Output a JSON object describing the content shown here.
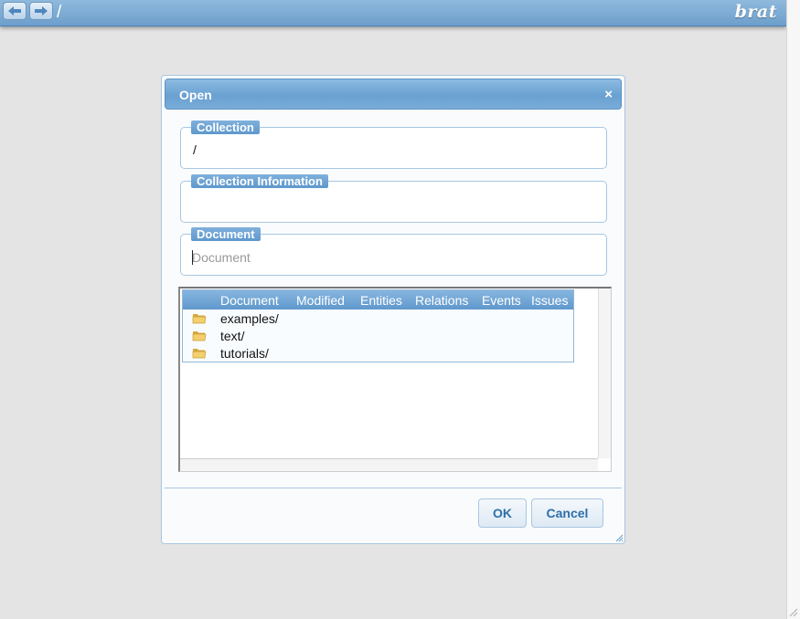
{
  "topbar": {
    "path": "/",
    "brand": "brat",
    "back_icon": "arrow-left-icon",
    "forward_icon": "arrow-right-icon"
  },
  "dialog": {
    "title": "Open",
    "close_label": "×",
    "collection": {
      "legend": "Collection",
      "value": "/"
    },
    "collection_info": {
      "legend": "Collection Information",
      "value": ""
    },
    "document": {
      "legend": "Document",
      "value": "",
      "placeholder": "Document"
    },
    "table": {
      "columns": [
        "Document",
        "Modified",
        "Entities",
        "Relations",
        "Events",
        "Issues"
      ],
      "rows": [
        {
          "icon": "folder-icon",
          "name": "examples/"
        },
        {
          "icon": "folder-icon",
          "name": "text/"
        },
        {
          "icon": "folder-icon",
          "name": "tutorials/"
        }
      ]
    },
    "buttons": {
      "ok": "OK",
      "cancel": "Cancel"
    }
  },
  "colors": {
    "accent": "#6aa1d1",
    "button_text": "#2e6fa9",
    "background": "#e4e4e4"
  }
}
